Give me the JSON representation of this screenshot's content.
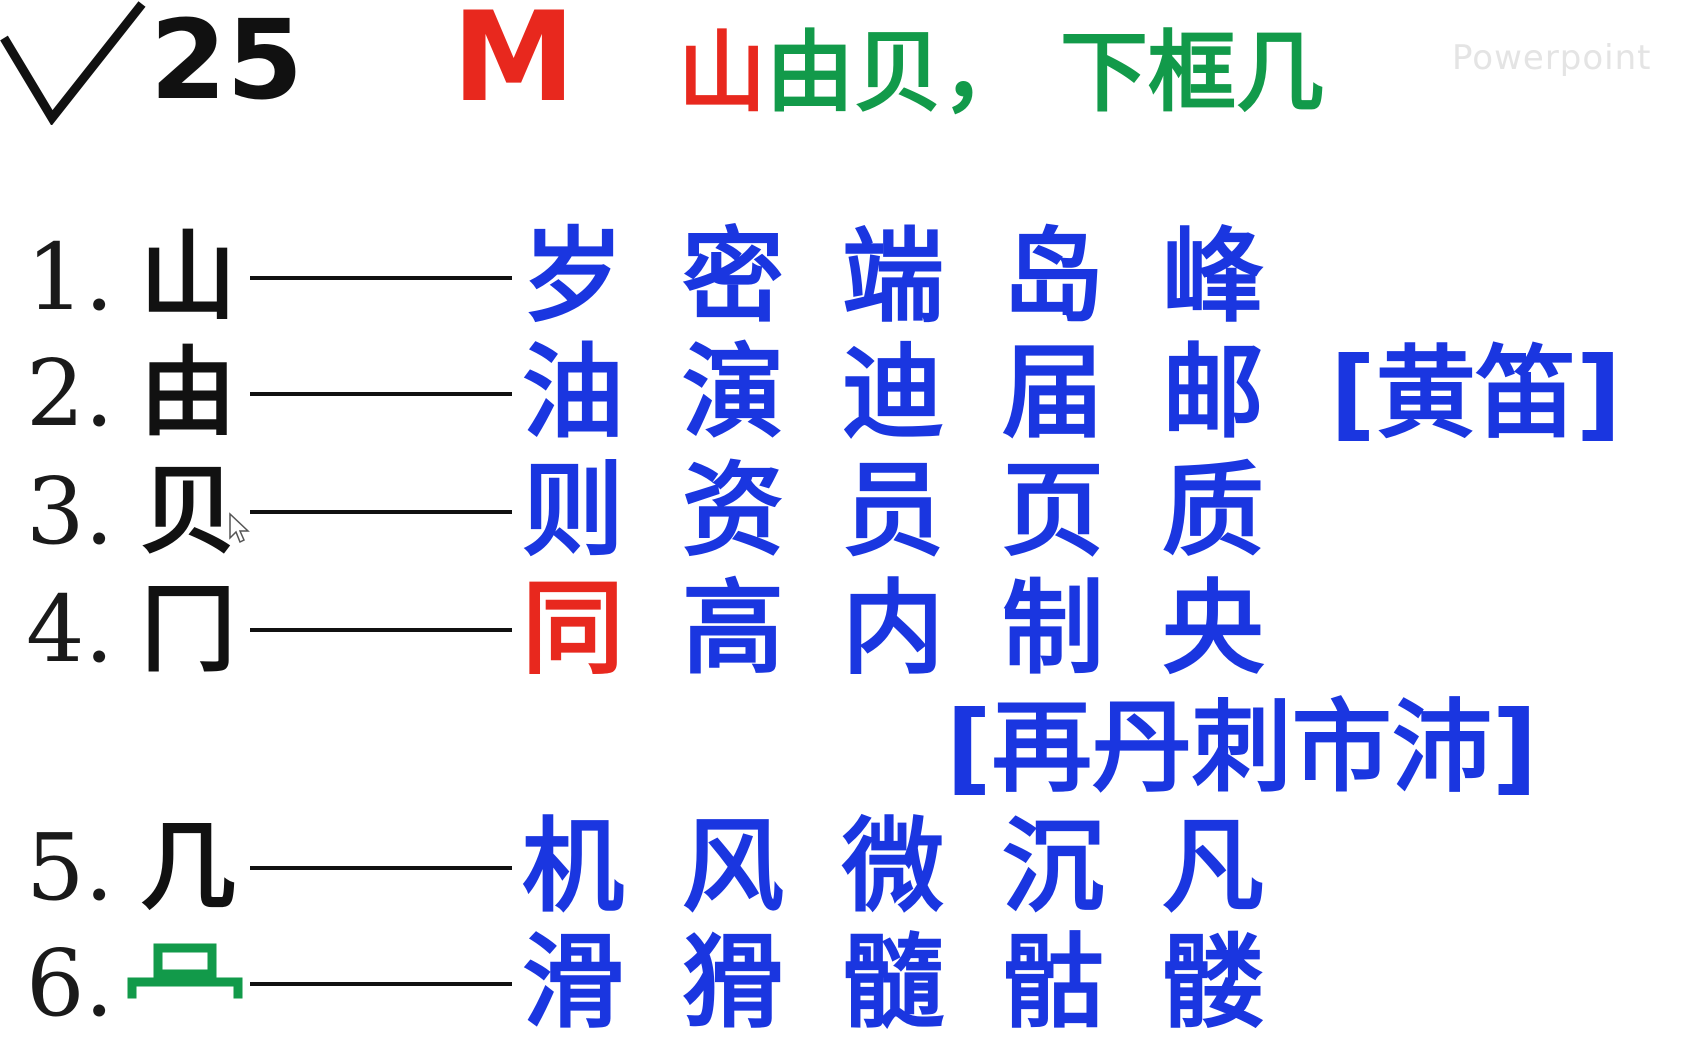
{
  "header": {
    "key_number": "25",
    "key_letter": "M",
    "mnemonic": [
      {
        "text": "山",
        "color": "#e8281e"
      },
      {
        "text": "由贝，",
        "color": "#129a4a"
      },
      {
        "text": "下框几",
        "color": "#129a4a"
      }
    ],
    "watermark": "Powerpoint"
  },
  "colors": {
    "red": "#e8281e",
    "green": "#129a4a",
    "blue": "#1a36e0",
    "black": "#111111"
  },
  "rows": [
    {
      "num": "1.",
      "radical": "山",
      "chars": [
        "岁",
        "密",
        "端",
        "岛",
        "峰"
      ],
      "extra": ""
    },
    {
      "num": "2.",
      "radical": "由",
      "chars": [
        "油",
        "演",
        "迪",
        "届",
        "邮"
      ],
      "extra": "[黄笛]"
    },
    {
      "num": "3.",
      "radical": "贝",
      "chars": [
        "则",
        "资",
        "员",
        "页",
        "质"
      ],
      "extra": ""
    },
    {
      "num": "4.",
      "radical": "冂",
      "chars": [
        "同",
        "高",
        "内",
        "制",
        "央"
      ],
      "extra": ""
    },
    {
      "num": "",
      "radical": "",
      "chars": [],
      "extra": "[再丹刺市沛]"
    },
    {
      "num": "5.",
      "radical": "几",
      "chars": [
        "机",
        "风",
        "微",
        "沉",
        "凡"
      ],
      "extra": ""
    },
    {
      "num": "6.",
      "radical": "",
      "chars": [
        "滑",
        "猾",
        "髓",
        "骷",
        "髅"
      ],
      "extra": ""
    }
  ]
}
